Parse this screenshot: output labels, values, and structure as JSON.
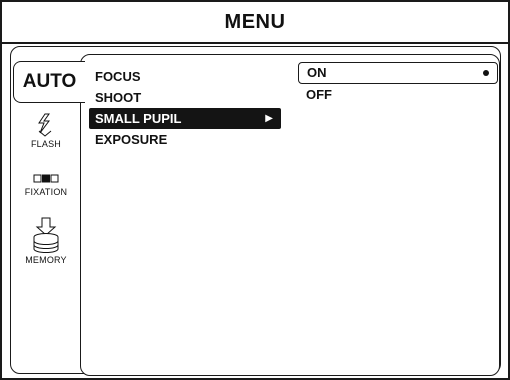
{
  "header": {
    "title": "MENU"
  },
  "sidebar": {
    "active_tab": "AUTO",
    "items": [
      {
        "label": "FLASH",
        "icon": "flash-icon"
      },
      {
        "label": "FIXATION",
        "icon": "fixation-icon"
      },
      {
        "label": "MEMORY",
        "icon": "memory-icon"
      }
    ]
  },
  "menu": {
    "items": [
      {
        "label": "FOCUS"
      },
      {
        "label": "SHOOT"
      },
      {
        "label": "SMALL PUPIL",
        "arrow": "▶"
      },
      {
        "label": "EXPOSURE"
      }
    ],
    "selected_index": 2
  },
  "options": {
    "items": [
      {
        "label": "ON"
      },
      {
        "label": "OFF"
      }
    ],
    "selected_index": 0
  },
  "colors": {
    "foreground": "#111111",
    "background": "#ffffff",
    "highlight": "#141414"
  }
}
